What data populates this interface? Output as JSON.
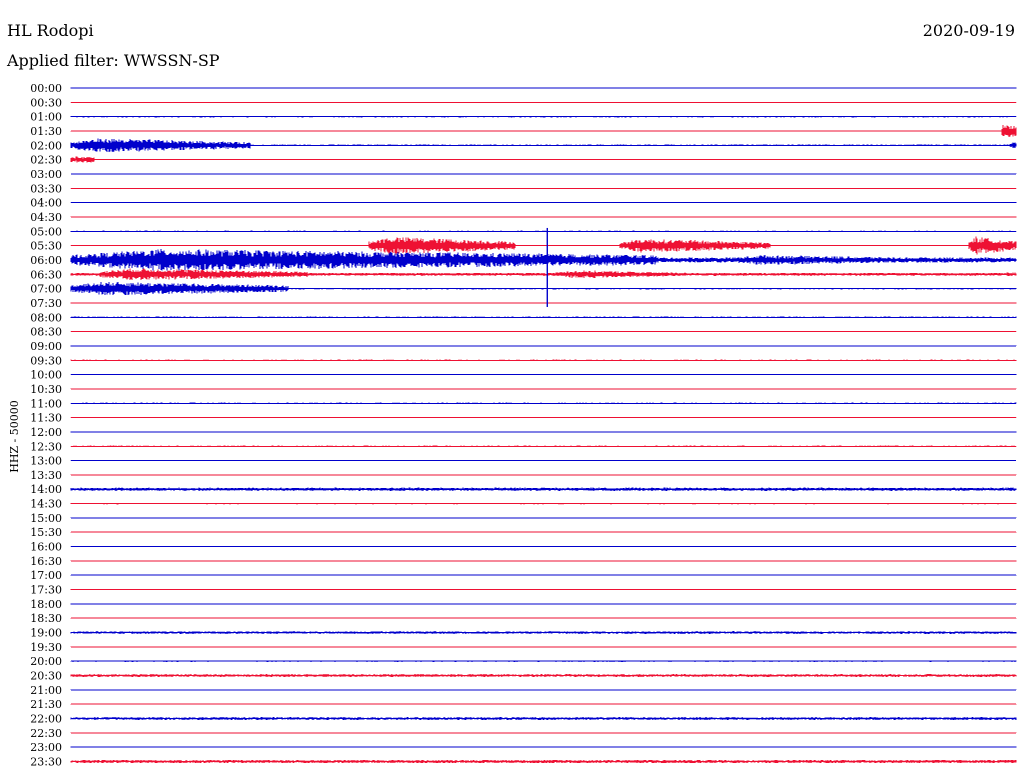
{
  "header": {
    "station": "HL Rodopi",
    "date": "2020-09-19",
    "filter": "Applied filter: WWSSN-SP"
  },
  "chart_data": {
    "type": "line",
    "ylabel": "HHZ - 50000",
    "colors": {
      "even": "#0000cc",
      "odd": "#ee1133"
    },
    "rows": [
      "00:00",
      "00:30",
      "01:00",
      "01:30",
      "02:00",
      "02:30",
      "03:00",
      "03:30",
      "04:00",
      "04:30",
      "05:00",
      "05:30",
      "06:00",
      "06:30",
      "07:00",
      "07:30",
      "08:00",
      "08:30",
      "09:00",
      "09:30",
      "10:00",
      "10:30",
      "11:00",
      "11:30",
      "12:00",
      "12:30",
      "13:00",
      "13:30",
      "14:00",
      "14:30",
      "15:00",
      "15:30",
      "16:00",
      "16:30",
      "17:00",
      "17:30",
      "18:00",
      "18:30",
      "19:00",
      "19:30",
      "20:00",
      "20:30",
      "21:00",
      "21:30",
      "22:00",
      "22:30",
      "23:00",
      "23:30"
    ],
    "background_noise": [
      0.6,
      0.4,
      0.7,
      0.6,
      0.8,
      0.6,
      0.4,
      0.4,
      0.5,
      0.4,
      0.6,
      0.5,
      2.5,
      1.5,
      0.8,
      0.5,
      0.7,
      0.4,
      0.5,
      0.6,
      0.6,
      0.4,
      0.6,
      0.5,
      0.5,
      0.6,
      0.4,
      0.5,
      1.6,
      0.7,
      0.4,
      0.5,
      0.6,
      0.5,
      0.4,
      0.6,
      0.5,
      0.5,
      1.3,
      0.6,
      0.6,
      1.4,
      0.5,
      0.4,
      1.4,
      0.5,
      0.5,
      1.6
    ],
    "events": [
      {
        "row": "01:30",
        "start": 0.985,
        "end": 1.0,
        "amplitude": 6
      },
      {
        "row": "02:00",
        "start": 0.0,
        "end": 0.19,
        "amplitude": 7
      },
      {
        "row": "02:00",
        "start": 0.993,
        "end": 1.0,
        "amplitude": 3
      },
      {
        "row": "02:30",
        "start": 0.0,
        "end": 0.025,
        "amplitude": 3
      },
      {
        "row": "05:30",
        "start": 0.315,
        "end": 0.47,
        "amplitude": 9
      },
      {
        "row": "05:30",
        "start": 0.58,
        "end": 0.74,
        "amplitude": 7
      },
      {
        "row": "05:30",
        "start": 0.95,
        "end": 1.0,
        "amplitude": 9
      },
      {
        "row": "06:00",
        "start": 0.0,
        "end": 0.62,
        "amplitude": 11
      },
      {
        "row": "06:00",
        "start": 0.7,
        "end": 0.9,
        "amplitude": 5
      },
      {
        "row": "06:30",
        "start": 0.03,
        "end": 0.25,
        "amplitude": 6
      },
      {
        "row": "06:30",
        "start": 0.51,
        "end": 0.65,
        "amplitude": 4
      },
      {
        "row": "06:30",
        "start": 0.99,
        "end": 1.0,
        "amplitude": 2
      },
      {
        "row": "07:00",
        "start": 0.0,
        "end": 0.23,
        "amplitude": 7
      }
    ]
  }
}
